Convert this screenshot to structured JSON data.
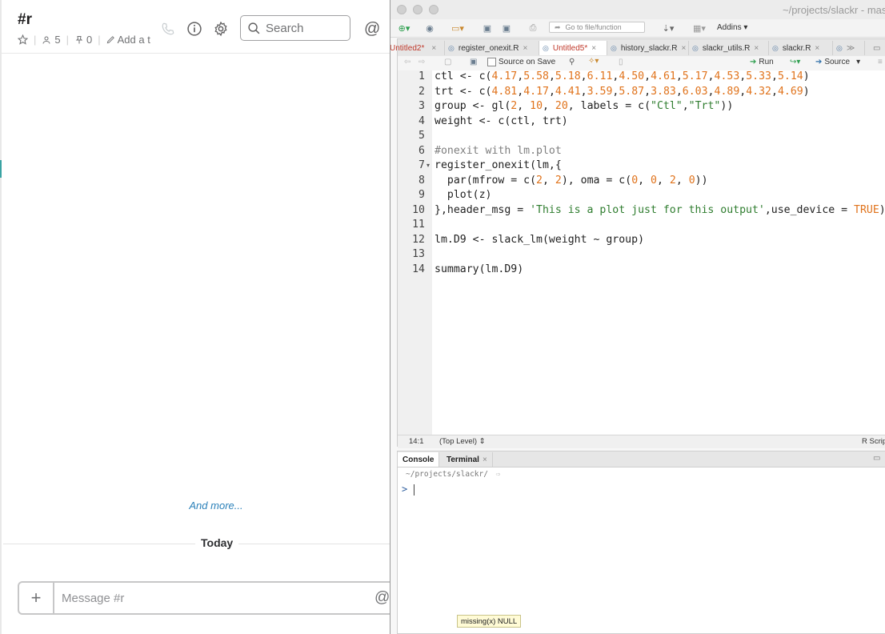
{
  "slack": {
    "channel_name": "#r",
    "member_count": "5",
    "pinned_count": "0",
    "add_topic": "Add a t",
    "search_placeholder": "Search",
    "and_more": "And more...",
    "divider_label": "Today",
    "message_placeholder": "Message #r"
  },
  "rstudio": {
    "window_title": "~/projects/slackr - master",
    "goto_placeholder": "Go to file/function",
    "addins_label": "Addins",
    "tabs": [
      {
        "label": "Untitled2*"
      },
      {
        "label": "register_onexit.R"
      },
      {
        "label": "Untitled5*"
      },
      {
        "label": "history_slackr.R"
      },
      {
        "label": "slackr_utils.R"
      },
      {
        "label": "slackr.R"
      }
    ],
    "source_on_save": "Source on Save",
    "run_label": "Run",
    "source_label": "Source",
    "code_lines": [
      {
        "n": "1"
      },
      {
        "n": "2"
      },
      {
        "n": "3"
      },
      {
        "n": "4"
      },
      {
        "n": "5"
      },
      {
        "n": "6"
      },
      {
        "n": "7"
      },
      {
        "n": "8"
      },
      {
        "n": "9"
      },
      {
        "n": "10"
      },
      {
        "n": "11"
      },
      {
        "n": "12"
      },
      {
        "n": "13"
      },
      {
        "n": "14"
      }
    ],
    "cursor_position": "14:1",
    "scope": "(Top Level)",
    "file_type": "R Script",
    "console_tab": "Console",
    "terminal_tab": "Terminal",
    "console_path": "~/projects/slackr/",
    "prompt": ">",
    "tooltip": "missing(x) NULL"
  },
  "code": {
    "l1": [
      "ctl <- c(",
      "4.17",
      ",",
      "5.58",
      ",",
      "5.18",
      ",",
      "6.11",
      ",",
      "4.50",
      ",",
      "4.61",
      ",",
      "5.17",
      ",",
      "4.53",
      ",",
      "5.33",
      ",",
      "5.14",
      ")"
    ],
    "l2": [
      "trt <- c(",
      "4.81",
      ",",
      "4.17",
      ",",
      "4.41",
      ",",
      "3.59",
      ",",
      "5.87",
      ",",
      "3.83",
      ",",
      "6.03",
      ",",
      "4.89",
      ",",
      "4.32",
      ",",
      "4.69",
      ")"
    ],
    "l3": [
      "group <- gl(",
      "2",
      ", ",
      "10",
      ", ",
      "20",
      ", labels = c(",
      "\"Ctl\"",
      ",",
      "\"Trt\"",
      "))"
    ],
    "l4": "weight <- c(ctl, trt)",
    "l6": "#onexit with lm.plot",
    "l7": "register_onexit(lm,{",
    "l8": [
      "  par(mfrow = c(",
      "2",
      ", ",
      "2",
      "), oma = c(",
      "0",
      ", ",
      "0",
      ", ",
      "2",
      ", ",
      "0",
      "))"
    ],
    "l9": "  plot(z)",
    "l10": [
      "},header_msg = ",
      "'This is a plot just for this output'",
      ",use_device = ",
      "TRUE",
      ")"
    ],
    "l12": "lm.D9 <- slack_lm(weight ~ group)",
    "l14": "summary(lm.D9)"
  }
}
